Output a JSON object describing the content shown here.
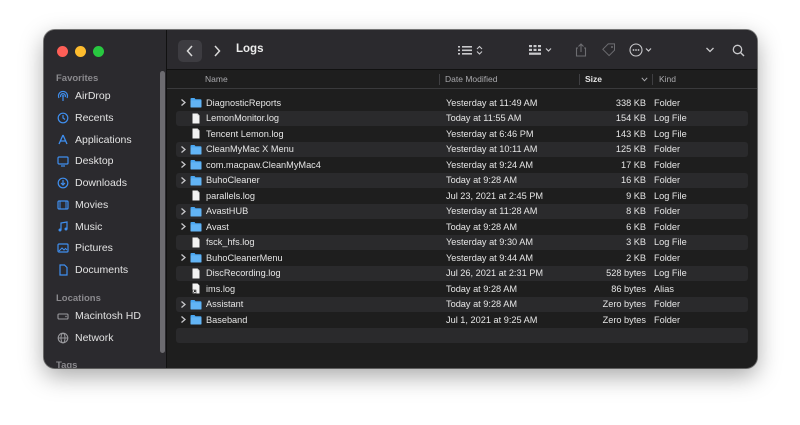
{
  "toolbar": {
    "title": "Logs"
  },
  "sidebar": {
    "sections": [
      {
        "label": "Favorites"
      },
      {
        "label": "Locations"
      },
      {
        "label": "Tags"
      }
    ],
    "favorites": [
      {
        "label": "AirDrop",
        "icon": "airdrop-icon"
      },
      {
        "label": "Recents",
        "icon": "clock-icon"
      },
      {
        "label": "Applications",
        "icon": "applications-icon"
      },
      {
        "label": "Desktop",
        "icon": "desktop-icon"
      },
      {
        "label": "Downloads",
        "icon": "downloads-icon"
      },
      {
        "label": "Movies",
        "icon": "movies-icon"
      },
      {
        "label": "Music",
        "icon": "music-icon"
      },
      {
        "label": "Pictures",
        "icon": "pictures-icon"
      },
      {
        "label": "Documents",
        "icon": "document-icon"
      }
    ],
    "locations": [
      {
        "label": "Macintosh HD",
        "icon": "disk-icon"
      },
      {
        "label": "Network",
        "icon": "network-icon"
      }
    ]
  },
  "columns": {
    "name": "Name",
    "date": "Date Modified",
    "size": "Size",
    "kind": "Kind"
  },
  "files": [
    {
      "name": "DiagnosticReports",
      "date": "Yesterday at 11:49 AM",
      "size": "338 KB",
      "kind": "Folder",
      "type": "folder"
    },
    {
      "name": "LemonMonitor.log",
      "date": "Today at 11:55 AM",
      "size": "154 KB",
      "kind": "Log File",
      "type": "file"
    },
    {
      "name": "Tencent Lemon.log",
      "date": "Yesterday at 6:46 PM",
      "size": "143 KB",
      "kind": "Log File",
      "type": "file"
    },
    {
      "name": "CleanMyMac X Menu",
      "date": "Yesterday at 10:11 AM",
      "size": "125 KB",
      "kind": "Folder",
      "type": "folder"
    },
    {
      "name": "com.macpaw.CleanMyMac4",
      "date": "Yesterday at 9:24 AM",
      "size": "17 KB",
      "kind": "Folder",
      "type": "folder"
    },
    {
      "name": "BuhoCleaner",
      "date": "Today at 9:28 AM",
      "size": "16 KB",
      "kind": "Folder",
      "type": "folder"
    },
    {
      "name": "parallels.log",
      "date": "Jul 23, 2021 at 2:45 PM",
      "size": "9 KB",
      "kind": "Log File",
      "type": "file"
    },
    {
      "name": "AvastHUB",
      "date": "Yesterday at 11:28 AM",
      "size": "8 KB",
      "kind": "Folder",
      "type": "folder"
    },
    {
      "name": "Avast",
      "date": "Today at 9:28 AM",
      "size": "6 KB",
      "kind": "Folder",
      "type": "folder"
    },
    {
      "name": "fsck_hfs.log",
      "date": "Yesterday at 9:30 AM",
      "size": "3 KB",
      "kind": "Log File",
      "type": "file"
    },
    {
      "name": "BuhoCleanerMenu",
      "date": "Yesterday at 9:44 AM",
      "size": "2 KB",
      "kind": "Folder",
      "type": "folder"
    },
    {
      "name": "DiscRecording.log",
      "date": "Jul 26, 2021 at 2:31 PM",
      "size": "528 bytes",
      "kind": "Log File",
      "type": "file"
    },
    {
      "name": "ims.log",
      "date": "Today at 9:28 AM",
      "size": "86 bytes",
      "kind": "Alias",
      "type": "alias"
    },
    {
      "name": "Assistant",
      "date": "Today at 9:28 AM",
      "size": "Zero bytes",
      "kind": "Folder",
      "type": "folder"
    },
    {
      "name": "Baseband",
      "date": "Jul 1, 2021 at 9:25 AM",
      "size": "Zero bytes",
      "kind": "Folder",
      "type": "folder"
    }
  ],
  "colors": {
    "accent": "#3b9cf5",
    "folder": "#4aa7f2",
    "sidebar_icon": "#3f8ff0"
  }
}
